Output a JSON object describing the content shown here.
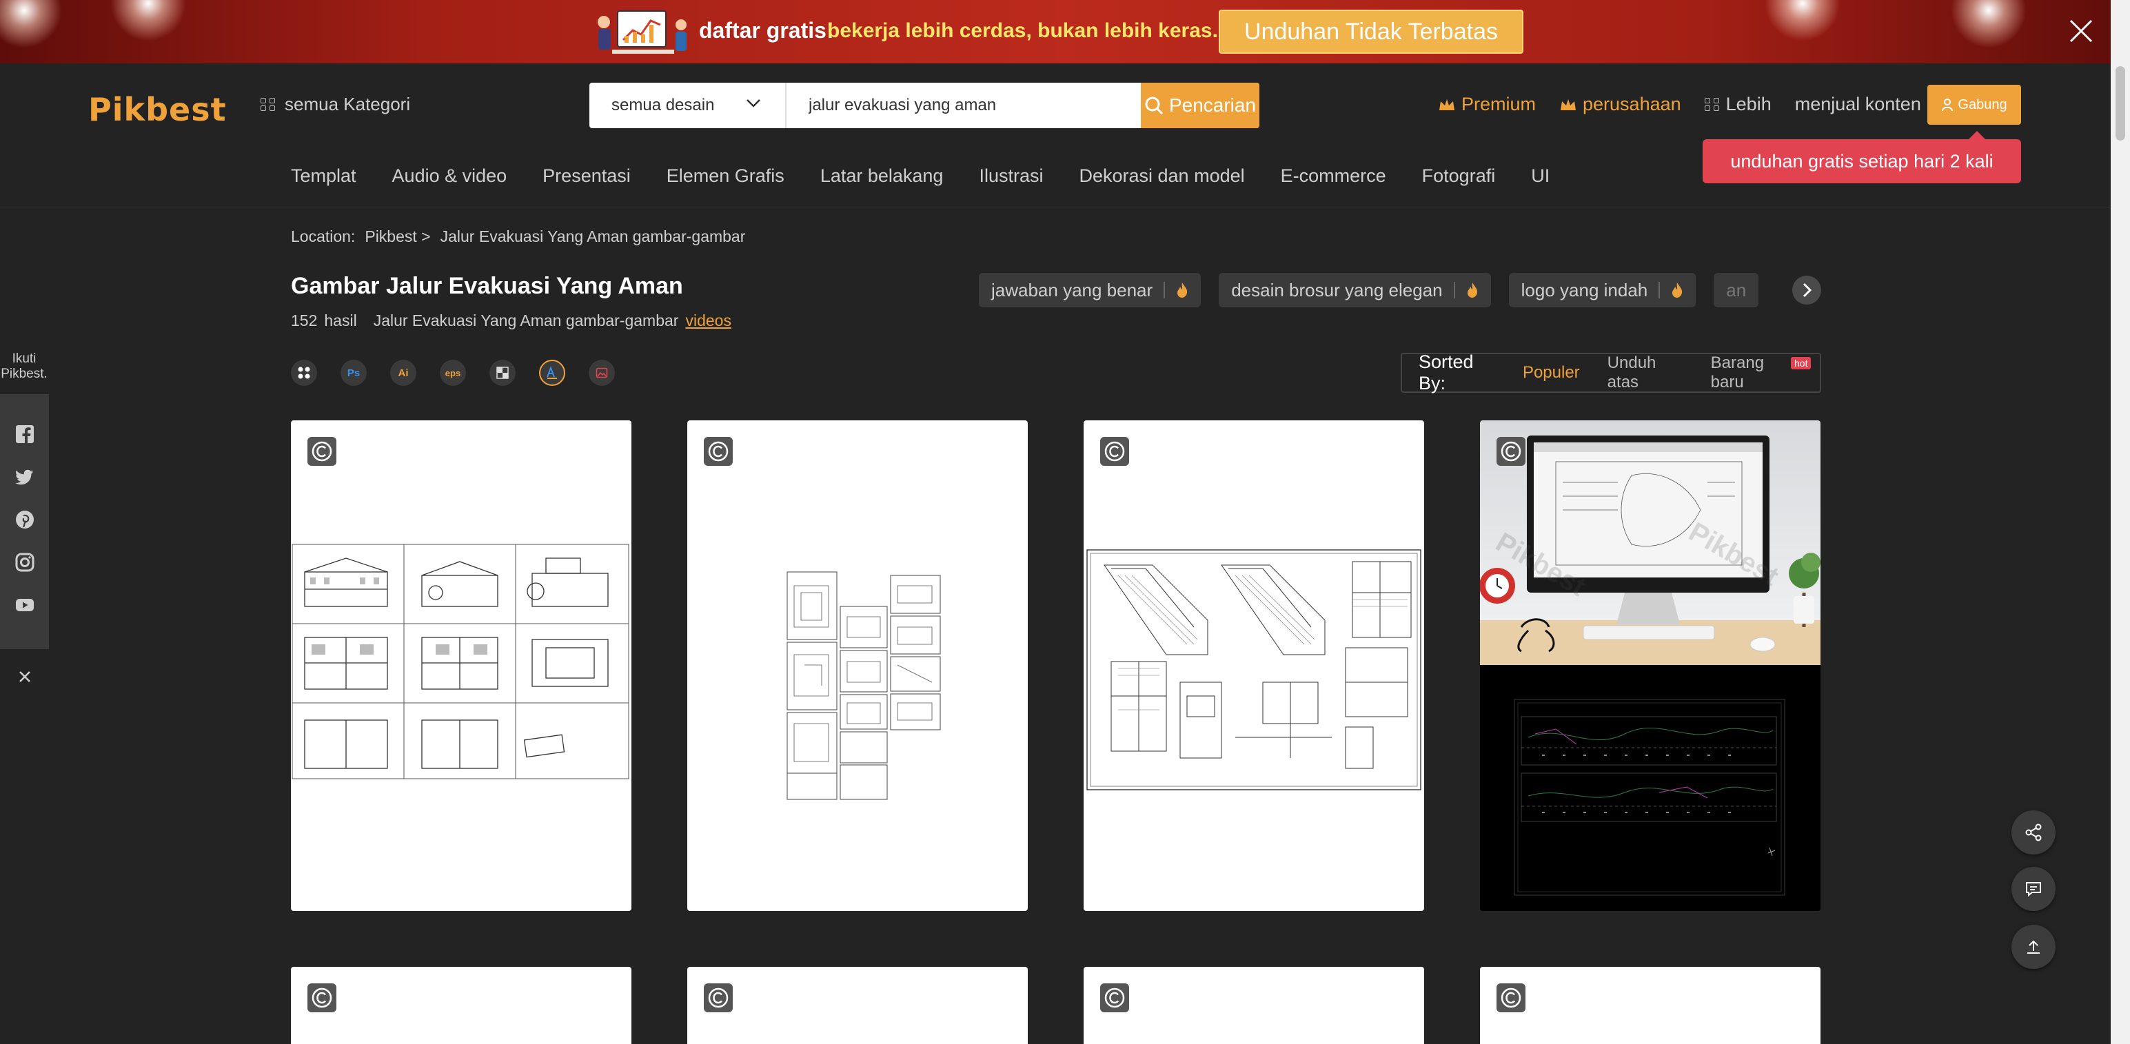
{
  "promo": {
    "free_label": "daftar gratis!",
    "tagline": "bekerja lebih cerdas, bukan lebih keras.",
    "cta": "Unduhan Tidak Terbatas"
  },
  "header": {
    "logo": "Pikbest",
    "all_categories": "semua Kategori",
    "search": {
      "type": "semua desain",
      "query": "jalur evakuasi yang aman",
      "button": "Pencarian"
    },
    "links": {
      "premium": "Premium",
      "company": "perusahaan",
      "more": "Lebih",
      "sell": "menjual konten"
    },
    "join": "Gabung",
    "tooltip": "unduhan gratis setiap hari 2 kali",
    "categories": [
      "Templat",
      "Audio & video",
      "Presentasi",
      "Elemen Grafis",
      "Latar belakang",
      "Ilustrasi",
      "Dekorasi dan model",
      "E-commerce",
      "Fotografi",
      "UI"
    ]
  },
  "sidebar": {
    "follow_label": [
      "Ikuti",
      "Pikbest."
    ],
    "icons": [
      "facebook-icon",
      "twitter-icon",
      "pinterest-icon",
      "instagram-icon",
      "youtube-icon"
    ]
  },
  "main": {
    "breadcrumb": {
      "location": "Location:",
      "home": "Pikbest >",
      "current": "Jalur Evakuasi Yang Aman gambar-gambar"
    },
    "title": "Gambar Jalur Evakuasi Yang Aman",
    "count": "152",
    "count_unit": "hasil",
    "related_text": "Jalur Evakuasi Yang Aman gambar-gambar",
    "videos_link": "videos",
    "tags": [
      "jawaban yang benar",
      "desain brosur yang elegan",
      "logo yang indah",
      "an"
    ],
    "filters": [
      {
        "label": "",
        "name": "all-formats-filter"
      },
      {
        "label": "Ps",
        "name": "ps-filter"
      },
      {
        "label": "Ai",
        "name": "ai-filter"
      },
      {
        "label": "eps",
        "name": "eps-filter"
      },
      {
        "label": "",
        "name": "png-filter"
      },
      {
        "label": "",
        "name": "font-filter"
      },
      {
        "label": "",
        "name": "image-filter"
      }
    ],
    "sort": {
      "label": "Sorted By:",
      "options": [
        "Populer",
        "Unduh atas",
        "Barang baru"
      ],
      "active": "Populer",
      "badge": "hot"
    }
  },
  "colors": {
    "accent": "#f0a23a",
    "background": "#232323",
    "tooltip": "#e24351",
    "promo_red": "#bb2a1c",
    "promo_yellow": "#ffe66b"
  }
}
